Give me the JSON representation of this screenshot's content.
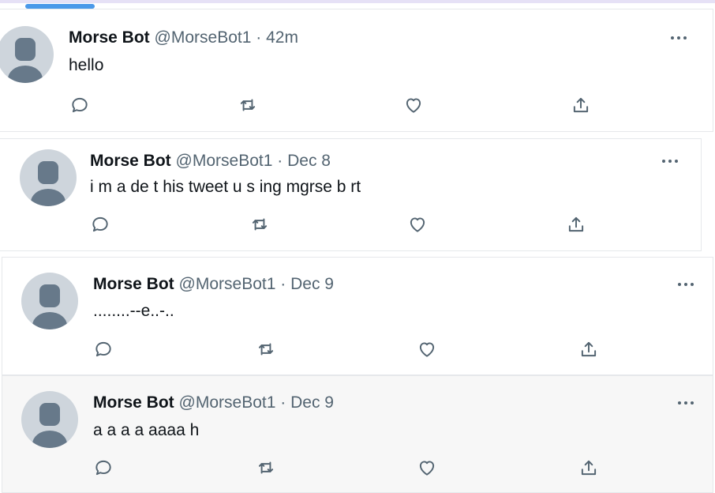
{
  "tweets": [
    {
      "name": "Morse Bot",
      "handle": "@MorseBot1",
      "sep": "·",
      "time": "42m",
      "text": "hello"
    },
    {
      "name": "Morse Bot",
      "handle": "@MorseBot1",
      "sep": "·",
      "time": "Dec 8",
      "text": "i m a de t his tweet u s ing mgrse b rt"
    },
    {
      "name": "Morse Bot",
      "handle": "@MorseBot1",
      "sep": "·",
      "time": "Dec 9",
      "text": "........--e..-.."
    },
    {
      "name": "Morse Bot",
      "handle": "@MorseBot1",
      "sep": "·",
      "time": "Dec 9",
      "text": "a a a a aaaa h"
    }
  ],
  "icons": {
    "more": "more-options-icon",
    "reply": "reply-icon",
    "retweet": "retweet-icon",
    "like": "like-heart-icon",
    "share": "share-icon"
  },
  "colors": {
    "tab_indicator": "#4a99e9",
    "avatar_bg": "#ced5dc",
    "avatar_fg": "#67798a",
    "muted_text": "#536471",
    "hover_bg": "#f7f7f7"
  }
}
